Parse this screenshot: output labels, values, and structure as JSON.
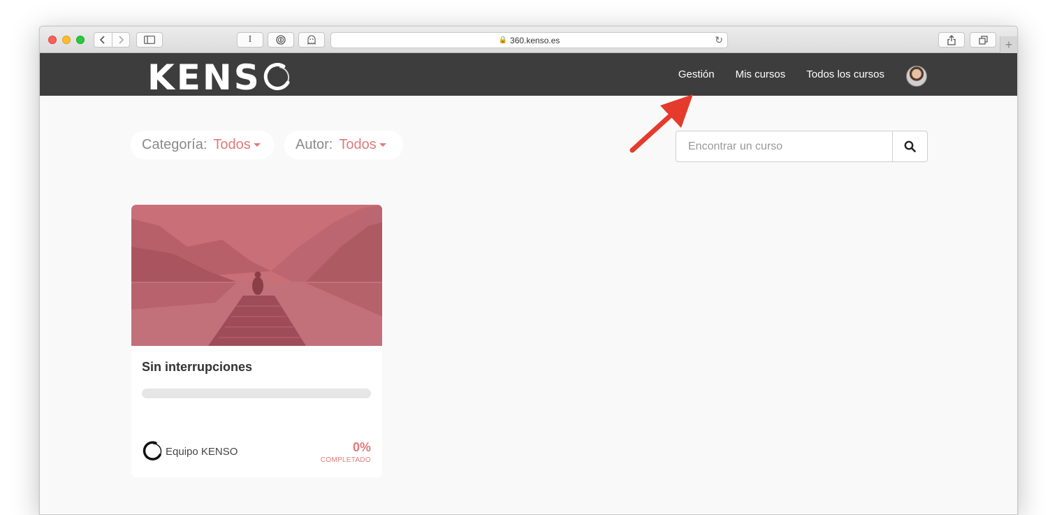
{
  "browser": {
    "url": "360.kenso.es",
    "reader_label": "I"
  },
  "brand": {
    "logo_text": "KENS"
  },
  "nav": {
    "links": [
      "Gestión",
      "Mis cursos",
      "Todos los cursos"
    ]
  },
  "filters": {
    "category_label": "Categoría:",
    "category_value": "Todos",
    "author_label": "Autor:",
    "author_value": "Todos"
  },
  "search": {
    "placeholder": "Encontrar un curso"
  },
  "course": {
    "title": "Sin interrupciones",
    "author": "Equipo KENSO",
    "progress_percent": 0,
    "progress_text": "0%",
    "progress_label": "COMPLETADO"
  },
  "colors": {
    "accent": "#e07a7a",
    "navbar": "#3d3d3d",
    "annotation_arrow": "#e53b2c"
  }
}
